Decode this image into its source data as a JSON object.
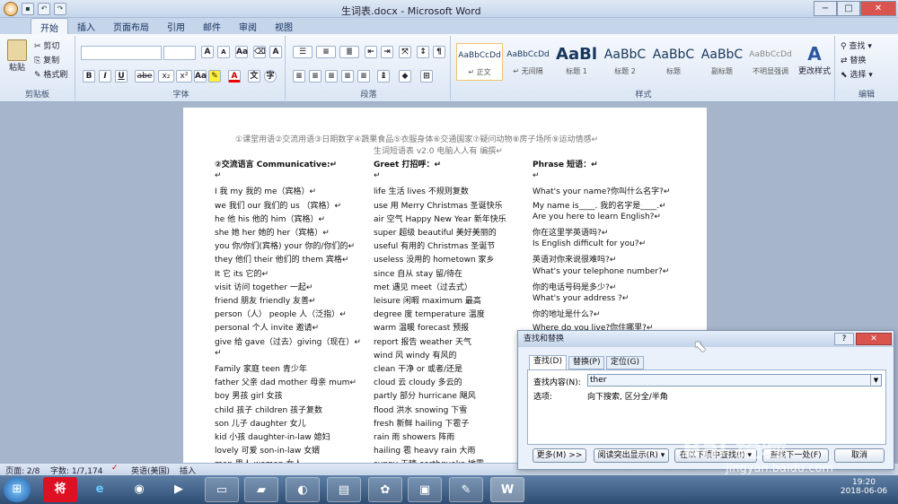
{
  "window": {
    "title": "生词表.docx - Microsoft Word",
    "minimize": "−",
    "maximize": "□",
    "close": "✕"
  },
  "tabs": [
    "开始",
    "插入",
    "页面布局",
    "引用",
    "邮件",
    "审阅",
    "视图"
  ],
  "ribbon": {
    "clipboard": {
      "label": "剪贴板",
      "paste": "粘贴",
      "cut": "剪切",
      "copy": "复制",
      "format_painter": "格式刷"
    },
    "font": {
      "label": "字体",
      "bold": "B",
      "italic": "I",
      "underline": "U",
      "strike": "abe",
      "sub": "x₂",
      "sup": "x²",
      "grow": "A",
      "shrink": "A"
    },
    "paragraph": {
      "label": "段落"
    },
    "styles": {
      "label": "样式",
      "items": [
        {
          "sample": "AaBbCcDd",
          "name": "↵ 正文"
        },
        {
          "sample": "AaBbCcDd",
          "name": "↵ 无间隔"
        },
        {
          "sample": "AaBl",
          "name": "标题 1"
        },
        {
          "sample": "AaBbC",
          "name": "标题 2"
        },
        {
          "sample": "AaBbC",
          "name": "标题"
        },
        {
          "sample": "AaBbC",
          "name": "副标题"
        },
        {
          "sample": "AaBbCcDd",
          "name": "不明显强调"
        }
      ],
      "change_styles": "更改样式"
    },
    "editing": {
      "label": "编辑",
      "find": "查找",
      "replace": "替换",
      "select": "选择"
    }
  },
  "document": {
    "header1": "①课堂用语②交流用语③日期数字④蔬果食品⑤衣服身体⑥交通国家⑦疑问动物⑧房子场所⑨运动情感↵",
    "header2": "生词短语表 v2.0 电脑人人有  编撰↵",
    "col1": [
      {
        "t": "②交流语言 Communicative:↵",
        "c": "b"
      },
      {
        "t": "↵",
        "c": ""
      },
      {
        "t": "I  我       my  我的         me（宾格）↵",
        "c": ""
      },
      {
        "t": "we  我们 our  我们的      us （宾格）↵",
        "c": ""
      },
      {
        "t": "he  他      his  他的          him（宾格）↵",
        "c": ""
      },
      {
        "t": "she  她    her  她的           her（宾格）↵",
        "c": ""
      },
      {
        "t": "you 你/你们(宾格) your 你的/你们的↵",
        "c": ""
      },
      {
        "t": "they 他们 their  他们的   them 宾格↵",
        "c": ""
      },
      {
        "t": "It  它   its  它的↵",
        "c": ""
      },
      {
        "t": "visit  访问             together  一起↵",
        "c": ""
      },
      {
        "t": "friend  朋友           friendly  友善↵",
        "c": ""
      },
      {
        "t": "person（人）          people  人（泛指）↵",
        "c": ""
      },
      {
        "t": "personal  个人          invite  邀请↵",
        "c": ""
      },
      {
        "t": "give  给  gave（过去）giving（现在）↵",
        "c": ""
      },
      {
        "t": "↵",
        "c": ""
      },
      {
        "t": "Family  家庭                   teen  青少年",
        "c": ""
      },
      {
        "t": "father  父亲  dad    mother 母亲  mum↵",
        "c": ""
      },
      {
        "t": "boy  男孩                               girl  女孩",
        "c": ""
      },
      {
        "t": "child  孩子              children  孩子复数",
        "c": ""
      },
      {
        "t": "son  儿子                       daughter  女儿",
        "c": ""
      },
      {
        "t": "kid  小孩                  daughter-in-law 媳妇",
        "c": ""
      },
      {
        "t": "lovely  可爱                  son-in-law  女婿",
        "c": ""
      },
      {
        "t": "man  男人                     woman  女人",
        "c": ""
      }
    ],
    "col2": [
      {
        "t": "Greet  打招呼：↵",
        "c": "b"
      },
      {
        "t": "↵",
        "c": ""
      },
      {
        "t": "life  生活                      lives  不规则复数",
        "c": ""
      },
      {
        "t": "use  用      Merry  Christmas  圣诞快乐",
        "c": ""
      },
      {
        "t": "air  空气   Happy  New  Year  新年快乐",
        "c": ""
      },
      {
        "t": "super  超级     beautiful  美好美丽的",
        "c": ""
      },
      {
        "t": "useful  有用的         Christmas  圣诞节",
        "c": ""
      },
      {
        "t": "useless  没用的          hometown  家乡",
        "c": ""
      },
      {
        "t": "since  自从                      stay  留/待在",
        "c": ""
      },
      {
        "t": "met  遇见                         meet（过去式）",
        "c": ""
      },
      {
        "t": "leisure  闲暇                   maximum  最高",
        "c": ""
      },
      {
        "t": "degree  度                 temperature  温度",
        "c": ""
      },
      {
        "t": "warm  温暖                         forecast  预报",
        "c": ""
      },
      {
        "t": "report  报告                          weather  天气",
        "c": ""
      },
      {
        "t": "wind  风                                windy  有风的",
        "c": ""
      },
      {
        "t": "clean  干净                             or  或者/还是",
        "c": ""
      },
      {
        "t": "cloud  云                              cloudy  多云的",
        "c": ""
      },
      {
        "t": "partly  部分                        hurricane  飓风",
        "c": ""
      },
      {
        "t": "flood  洪水                             snowing  下雪",
        "c": ""
      },
      {
        "t": "fresh  新鲜                              hailing  下雹子",
        "c": ""
      },
      {
        "t": "rain  雨                                  showers  阵雨",
        "c": ""
      },
      {
        "t": "hailing  雹                              heavy rain  大雨",
        "c": ""
      },
      {
        "t": "sunny  天晴                           earthquake  地震",
        "c": ""
      }
    ],
    "col3": [
      {
        "t": "Phrase  短语：↵",
        "c": "b"
      },
      {
        "t": "↵",
        "c": ""
      },
      {
        "t": "What's your name?你叫什么名字?↵",
        "c": ""
      },
      {
        "t": "My name is____.  我的名字是____.↵",
        "c": ""
      },
      {
        "t": "Are you here to learn English?↵",
        "c": ""
      },
      {
        "t": "你在这里学英语吗?↵",
        "c": ""
      },
      {
        "t": "Is English difficult  for you?↵",
        "c": ""
      },
      {
        "t": "英语对你来说很难吗?↵",
        "c": ""
      },
      {
        "t": "What's your telephone number?↵",
        "c": ""
      },
      {
        "t": "你的电话号码是多少?↵",
        "c": ""
      },
      {
        "t": "What's your address ?↵",
        "c": ""
      },
      {
        "t": "你的地址是什么?↵",
        "c": ""
      },
      {
        "t": "Where do you live?你住哪里?↵",
        "c": ""
      }
    ]
  },
  "status": {
    "page": "页面: 2/8",
    "words": "字数: 1/7,174",
    "language": "英语(美国)",
    "mode": "插入"
  },
  "dialog": {
    "title": "查找和替换",
    "help": "?",
    "close": "✕",
    "tabs": [
      "查找(D)",
      "替换(P)",
      "定位(G)"
    ],
    "find_label": "查找内容(N):",
    "find_value": "ther",
    "options_label": "选项:",
    "options_value": "向下搜索, 区分全/半角",
    "more": "更多(M) >>",
    "highlight": "阅读突出显示(R) ▾",
    "find_in": "在以下项中查找(I) ▾",
    "find_next": "查找下一处(F)",
    "cancel": "取消"
  },
  "taskbar": {
    "clock_time": "19:20",
    "clock_date": "2018-06-06"
  },
  "watermark": {
    "text": "Bai 经验",
    "url": "jingyan.baidu.com"
  }
}
